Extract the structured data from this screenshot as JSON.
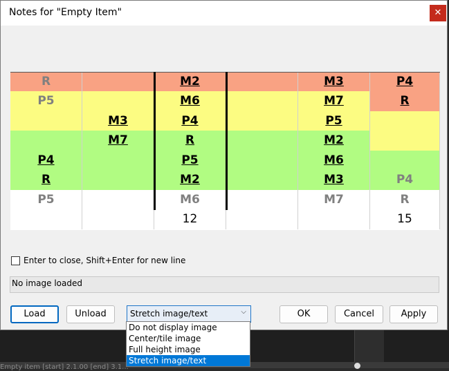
{
  "dialog": {
    "title": "Notes for \"Empty Item\"",
    "close_glyph": "✕"
  },
  "preview": {
    "colors": {
      "orange": "#f9a283",
      "yellow": "#fcfc82",
      "green": "#b1fc82",
      "white": "#ffffff"
    },
    "rows": [
      {
        "color": "orange",
        "cells": [
          {
            "t": "R",
            "s": "g"
          },
          {
            "t": "",
            "s": ""
          },
          {
            "t": "M2",
            "s": "u"
          },
          {
            "t": "",
            "s": ""
          },
          {
            "t": "M3",
            "s": "u"
          },
          {
            "t": "P4",
            "s": "u"
          }
        ]
      },
      {
        "color": "yellow",
        "cells": [
          {
            "t": "P5",
            "s": "g"
          },
          {
            "t": "",
            "s": ""
          },
          {
            "t": "M6",
            "s": "u"
          },
          {
            "t": "",
            "s": ""
          },
          {
            "t": "M7",
            "s": "u"
          },
          {
            "t": "R",
            "s": "u",
            "bg": "orange"
          }
        ]
      },
      {
        "color": "yellow",
        "cells": [
          {
            "t": "",
            "s": ""
          },
          {
            "t": "M3",
            "s": "u"
          },
          {
            "t": "P4",
            "s": "u"
          },
          {
            "t": "",
            "s": ""
          },
          {
            "t": "P5",
            "s": "u"
          },
          {
            "t": "",
            "s": ""
          }
        ]
      },
      {
        "color": "green",
        "cells": [
          {
            "t": "",
            "s": ""
          },
          {
            "t": "M7",
            "s": "u"
          },
          {
            "t": "R",
            "s": "u"
          },
          {
            "t": "",
            "s": ""
          },
          {
            "t": "M2",
            "s": "u"
          },
          {
            "t": "",
            "s": "",
            "bg": "yellow"
          }
        ]
      },
      {
        "color": "green",
        "cells": [
          {
            "t": "P4",
            "s": "u"
          },
          {
            "t": "",
            "s": ""
          },
          {
            "t": "P5",
            "s": "u"
          },
          {
            "t": "",
            "s": ""
          },
          {
            "t": "M6",
            "s": "u"
          },
          {
            "t": "",
            "s": ""
          }
        ]
      },
      {
        "color": "green",
        "cells": [
          {
            "t": "R",
            "s": "u"
          },
          {
            "t": "",
            "s": ""
          },
          {
            "t": "M2",
            "s": "u"
          },
          {
            "t": "",
            "s": ""
          },
          {
            "t": "M3",
            "s": "u"
          },
          {
            "t": "P4",
            "s": "g"
          }
        ]
      },
      {
        "color": "white",
        "cells": [
          {
            "t": "P5",
            "s": "g"
          },
          {
            "t": "",
            "s": ""
          },
          {
            "t": "M6",
            "s": "g"
          },
          {
            "t": "",
            "s": ""
          },
          {
            "t": "M7",
            "s": "g"
          },
          {
            "t": "R",
            "s": "g"
          }
        ]
      },
      {
        "color": "white",
        "cells": [
          {
            "t": "",
            "s": ""
          },
          {
            "t": "",
            "s": ""
          },
          {
            "t": "12",
            "s": "n"
          },
          {
            "t": "",
            "s": ""
          },
          {
            "t": "",
            "s": ""
          },
          {
            "t": "15",
            "s": "n"
          }
        ]
      }
    ]
  },
  "checkbox": {
    "label": "Enter to close, Shift+Enter for new line",
    "checked": false
  },
  "status": {
    "text": "No image loaded"
  },
  "buttons": {
    "load": "Load",
    "unload": "Unload",
    "ok": "OK",
    "cancel": "Cancel",
    "apply": "Apply"
  },
  "combo": {
    "selected": "Stretch image/text",
    "chevron": "⌵",
    "options": [
      "Do not display image",
      "Center/tile image",
      "Full height image",
      "Stretch image/text"
    ]
  },
  "background": {
    "status_text": "Empty item [start] 2.1.00 [end] 3.1..."
  }
}
